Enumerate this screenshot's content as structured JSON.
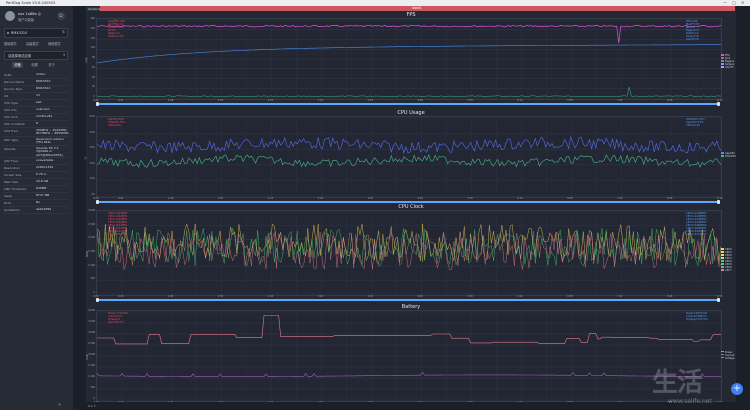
{
  "window": {
    "title": "PerfDog Scale V3.6.240903",
    "controls": [
      "—",
      "□",
      "✕"
    ]
  },
  "user": {
    "name": "xxx 1x86x ◎",
    "label": "用户中级版",
    "logout_icon": "logout-icon"
  },
  "device": {
    "name": "RMX3310",
    "chevron": "⇅"
  },
  "menu": [
    "基础模式",
    "高级模式",
    "网络模式"
  ],
  "app": {
    "name": "请选择测试应用",
    "chevron": "▾"
  },
  "tabs": [
    {
      "label": "设备"
    },
    {
      "label": "设置"
    },
    {
      "label": "关于"
    }
  ],
  "info_rows": [
    {
      "k": "SoRx",
      "v": "Vidour"
    },
    {
      "k": "Device Name",
      "v": "RMX3310"
    },
    {
      "k": "Device Type",
      "v": "RMX3310"
    },
    {
      "k": "OS",
      "v": "13"
    },
    {
      "k": "CPU Type",
      "v": "kalt"
    },
    {
      "k": "CPU Info",
      "v": "unknown"
    },
    {
      "k": "CPU Arch",
      "v": "arm64-v8a"
    },
    {
      "k": "CPU Coreflare",
      "v": "8"
    },
    {
      "k": "CPU Freq",
      "v": "300MHz ~ 2022MHz\n8573MHz ~ 8559MHz"
    },
    {
      "k": "GPU Type",
      "v": "Qualcomm Adreno\n(TM) 642L"
    },
    {
      "k": "OpenGL",
      "v": "OpenGL ES 3.2\nV@0661.0\n(GIT@9f6e2055b)"
    },
    {
      "k": "GPU Freq",
      "v": "unavailable"
    },
    {
      "k": "Resolution",
      "v": "2280x1344"
    },
    {
      "k": "Screen Size",
      "v": "6.76 in"
    },
    {
      "k": "Main Size",
      "v": "16.8 GB"
    },
    {
      "k": "LMK Threshold",
      "v": "640MB"
    },
    {
      "k": "Swap",
      "v": "8727 MB"
    },
    {
      "k": "Root",
      "v": "No"
    },
    {
      "k": "SerialNum",
      "v": "ab912899"
    }
  ],
  "sidebar_collapse_icon": "«",
  "chip": "Global Set",
  "topbar_label": "label1",
  "panels": [
    {
      "title": "FPS",
      "ylabel": "FPS",
      "yticks": [
        "160",
        "140",
        "120",
        "100",
        "80",
        "60",
        "40",
        "20",
        "0"
      ],
      "stats": [
        "Avg(FPS):118",
        "Var(FPS):2.3",
        "Smooth:99.3",
        "Jank:0",
        "BigJank:0",
        "Stutter:0.0%"
      ],
      "stat_colors": [
        "#e84a5f",
        "#e84a5f",
        "#e84a5f",
        "#e84a5f",
        "#e84a5f",
        "#e84a5f"
      ],
      "right_stats": [
        "FPS=120",
        "MaxFT=55",
        "Jank=0",
        "BigJank=0",
        "Stutter=0",
        "SmJank=0",
        "InterFT=8"
      ],
      "legend": [
        {
          "name": "FPS",
          "color": "#e255d8"
        },
        {
          "name": "Jank",
          "color": "#e84a5f"
        },
        {
          "name": "BigJank",
          "color": "#4a8ef2"
        },
        {
          "name": "SmJank",
          "color": "#b978ff"
        },
        {
          "name": "InterFT",
          "color": "#5ec7e8"
        }
      ]
    },
    {
      "title": "CPU Usage",
      "ylabel": "%",
      "yticks": [
        "50%",
        "40%",
        "30%",
        "20%",
        "10%",
        "0%"
      ],
      "stats": [
        "AppCPU:48%",
        "TotalCPU:35%",
        "CTemp:0%"
      ],
      "stat_colors": [
        "#e84a5f",
        "#e84a5f",
        "#e84a5f"
      ],
      "right_stats": [
        "TotalCPU=31%",
        "AppCPU=16%",
        "CTemp=40"
      ],
      "legend": [
        {
          "name": "AppCPU",
          "color": "#4a8ef2"
        },
        {
          "name": "TotalCPU",
          "color": "#48b88a"
        }
      ]
    },
    {
      "title": "CPU Clock",
      "ylabel": "MHz",
      "yticks": [
        "3,000",
        "2,500",
        "2,000",
        "1,500",
        "1,000",
        "500",
        "0"
      ],
      "stats": [
        "CPU0:1049MHz",
        "CPU1:1049MHz",
        "CPU2:1049MHz",
        "CPU3:1049MHz",
        "CPU4:1612MHz",
        "CPU5:1612MHz",
        "CPU6:1612MHz",
        "CPU7:1650MHz"
      ],
      "stat_colors": [
        "#e84a5f",
        "#e84a5f",
        "#e84a5f",
        "#e84a5f",
        "#e84a5f",
        "#e84a5f",
        "#e84a5f",
        "#e84a5f"
      ],
      "right_stats": [
        "CPU0=1248MHz",
        "CPU1=1248MHz",
        "CPU2=1248MHz",
        "CPU3=1248MHz",
        "CPU4=1900MHz",
        "CPU5=1900MHz",
        "CPU6=1900MHz",
        "CPU7=2131MHz"
      ],
      "legend": [
        {
          "name": "CPU0",
          "color": "#f4d35e"
        },
        {
          "name": "CPU1",
          "color": "#f4d35e"
        },
        {
          "name": "CPU2",
          "color": "#f4d35e"
        },
        {
          "name": "CPU3",
          "color": "#f4d35e"
        },
        {
          "name": "CPU4",
          "color": "#4ecb71"
        },
        {
          "name": "CPU5",
          "color": "#4ecb71"
        },
        {
          "name": "CPU6",
          "color": "#4ecb71"
        },
        {
          "name": "CPU7",
          "color": "#e87a8c"
        }
      ]
    },
    {
      "title": "Battery",
      "ylabel": "mW",
      "yticks": [
        "4,000",
        "3,500",
        "3,000",
        "2,500",
        "2,000",
        "1,500",
        "1,000",
        "500",
        "0"
      ],
      "stats": [
        "Power:2745mW",
        "Current:3.5",
        "Voltage:0",
        "Temp:35.5°C"
      ],
      "stat_colors": [
        "#e84a5f",
        "#e84a5f",
        "#e84a5f",
        "#e84a5f"
      ],
      "right_stats": [
        "Power=2657mW",
        "Current=668mA",
        "Voltage=3977mV"
      ],
      "legend": [
        {
          "name": "Power",
          "color": "#e87a8c"
        },
        {
          "name": "Current",
          "color": "#a55cc4"
        },
        {
          "name": "Voltage",
          "color": "#5e8ee8"
        }
      ]
    }
  ],
  "xticks": [
    "0:00",
    "0:22",
    "0:44",
    "1:06",
    "1:28",
    "1:50",
    "2:12",
    "2:34",
    "2:56",
    "3:18",
    "3:40",
    "4:02",
    "4:24",
    "4:46",
    "5:08",
    "5:30",
    "5:52",
    "6:14",
    "6:36",
    "6:58",
    "7:20",
    "7:42",
    "8:04",
    "8:26",
    "8:48",
    "9:10"
  ],
  "bottom_text": "0.1.7",
  "add_button": "+",
  "watermark": "生活",
  "watermark_url": "www.selife.net"
}
